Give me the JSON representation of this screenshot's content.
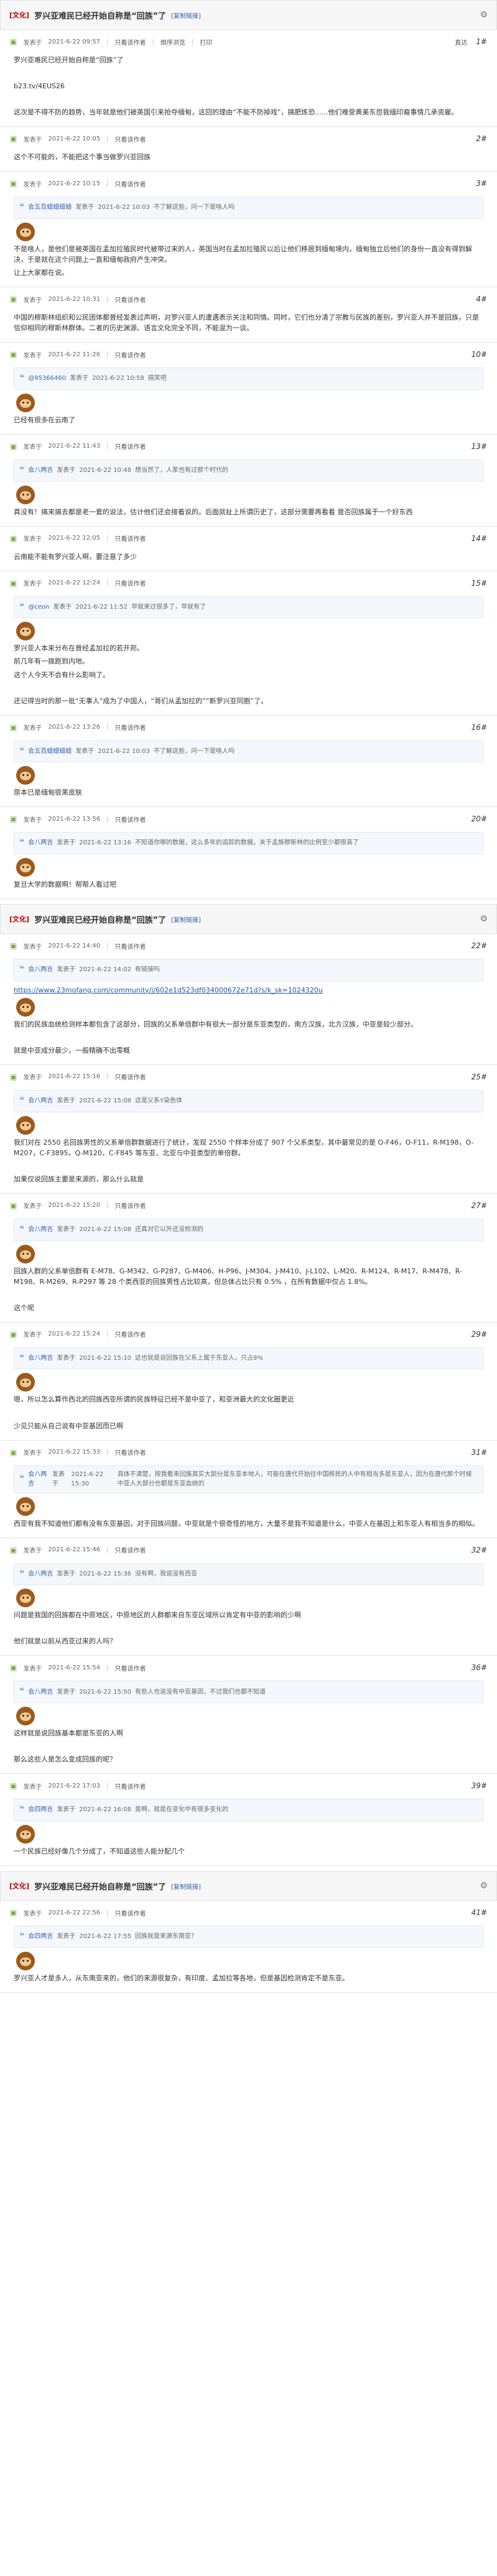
{
  "thread": {
    "category": "[文化]",
    "title": "罗兴亚难民已经开始自称是“回族”了",
    "copy": "[复制链接]",
    "tools_icon": "gear-icon"
  },
  "common": {
    "posted_prefix": "发表于",
    "only_author": "只看该作者",
    "reverse": "倒序浏览",
    "print": "打印",
    "jump": "直达"
  },
  "posts": [
    {
      "floor": "1#",
      "time": "2021-6-22 09:57",
      "meta_extra": true,
      "body": [
        "罗兴亚难民已经开始自称是“回族”了",
        "",
        "b23.tv/4EUS26",
        "",
        "这次是不得不防的趋势，当年就是他们被英国引来抢夺缅甸，这回的理由“不能不防掉戏”，搞肥炼恐......他们难受黄美东怨我缅印裔事情几承资雇。"
      ]
    },
    {
      "floor": "2#",
      "time": "2021-6-22 10:05",
      "body": [
        "这个不可能的，不能把这个事当做罗兴亚回族"
      ]
    },
    {
      "floor": "3#",
      "time": "2021-6-22 10:15",
      "quote": {
        "user": "会五百蜡蜡蜡蜡",
        "time": "2021-6-22 10:03",
        "text": "不了解这些，问一下是啥人吗"
      },
      "body": [
        "不是啥人，是他们是被英国在孟加拉殖民时代被带过来的人，英国当时在孟加拉殖民以后让他们移居到缅甸境内，缅甸独立后他们的身份一直没有得到解决，于是就在这个问题上一直和缅甸政府产生冲突。",
        "让上大家都在说。"
      ]
    },
    {
      "floor": "4#",
      "time": "2021-6-22 10:31",
      "body": [
        "中国的穆斯林组织和公民团体都曾经发表过声明，对罗兴亚人的遭遇表示关注和同情。同时，它们也分清了宗教与民族的差别，罗兴亚人并不是回族，只是信仰相同的穆斯林群体。二者的历史渊源、语言文化完全不同，不能混为一谈。"
      ]
    },
    {
      "floor": "10#",
      "time": "2021-6-22 11:26",
      "quote": {
        "user": "@95366460",
        "time": "2021-6-22 10:58",
        "text": "搞笑吧"
      },
      "body": [
        "已经有很多在云南了"
      ]
    },
    {
      "floor": "13#",
      "time": "2021-6-22 11:43",
      "quote": {
        "user": "会八两吉",
        "time": "2021-6-22 10:48",
        "text": "想当然了，人家也有过那个时代的"
      },
      "body": [
        "真没有！搞来搞去都是老一套的说法，估计他们还会接着说的。后面就扯上所谓历史了，这部分需要再看看 是否回族属于一个好东西"
      ]
    },
    {
      "floor": "14#",
      "time": "2021-6-22 12:05",
      "body": [
        "云南能不能有罗兴亚人啊，要注意了多少"
      ]
    },
    {
      "floor": "15#",
      "time": "2021-6-22 12:24",
      "quote": {
        "user": "@ceon",
        "time": "2021-6-22 11:52",
        "text": "早就来过很多了，早就有了"
      },
      "body": [
        "罗兴亚人本来分布在曾经孟加拉的若开邦。",
        "前几年有一拨跑到内地。",
        "这个人今天不会有什么影响了。",
        "",
        "还记得当时的那一批“无事人”成为了中国人，“哥们从孟加拉的”“新罗兴亚同胞”了。"
      ]
    },
    {
      "floor": "16#",
      "time": "2021-6-22 13:26",
      "quote": {
        "user": "会五百蜡蜡蜡蜡",
        "time": "2021-6-22 10:03",
        "text": "不了解这些，问一下是啥人吗"
      },
      "body": [
        "原本已是缅甸很黑皮肤"
      ]
    },
    {
      "floor": "20#",
      "time": "2021-6-22 13:56",
      "quote": {
        "user": "会八两吉",
        "time": "2021-6-22 13:16",
        "text": "不知道你哪的数据，这么多年的追踪的数据，关于孟族穆斯林的比例至少都很高了"
      },
      "body": [
        "复旦大学的数据啊！帮帮人看过吧"
      ]
    }
  ],
  "thread2": {
    "category": "[文化]",
    "title": "罗兴亚难民已经开始自称是“回族”了",
    "copy": "[复制链接]"
  },
  "posts2": [
    {
      "floor": "22#",
      "time": "2021-6-22 14:40",
      "quote": {
        "user": "会八两吉",
        "time": "2021-6-22 14:02",
        "text": "有链接吗"
      },
      "link": "https://www.23mofang.com/community/i/602e1d523df034000672e71d?s/k_sk=1024320u",
      "body": [
        "我们的民族血统检测样本都包含了这部分，回族的父系单倍群中有很大一部分是东亚类型的，南方汉族，北方汉族，中亚是较少部分。",
        "",
        "就是中亚成分最少，一般精确不出零概"
      ]
    },
    {
      "floor": "25#",
      "time": "2021-6-22 15:16",
      "quote": {
        "user": "会八两吉",
        "time": "2021-6-22 15:08",
        "text": "这是父系Y染色体"
      },
      "body": [
        "我们对在 2550 名回族男性的父系单倍群数据进行了统计，发现 2550 个样本分成了 907 个父系类型，其中最常见的是 O-F46，O-F11，R-M198，O-M207，C-F3895，Q-M120，C-F845 等东亚、北亚与中亚类型的单倍群。",
        "",
        "加果仅说回族主要是来源的，那么什么就是"
      ]
    },
    {
      "floor": "27#",
      "time": "2021-6-22 15:20",
      "quote": {
        "user": "会八两吉",
        "time": "2021-6-22 15:08",
        "text": "还真对它以外还没检测的"
      },
      "body": [
        "回族人群的父系单倍群有 E-M78、G-M342、G-P287、G-M406、H-P96、J-M304、J-M410、J-L102、L-M20、R-M124、R-M17、R-M478、R-M198、R-M269、R-P297 等 28 个类西亚的回族男性占比较高，但总体占比只有 0.5% ，在所有数据中仅占 1.8%。",
        "",
        "这个呢"
      ]
    },
    {
      "floor": "29#",
      "time": "2021-6-22 15:24",
      "quote": {
        "user": "会八两吉",
        "time": "2021-6-22 15:10",
        "text": "这也就是说回族在父系上属于东亚人，只占9%"
      },
      "body": [
        "嗯，所以怎么算作西北的回族西亚所谓的民族特征已经不是中亚了，和亚洲最大的文化圈更近",
        "",
        "少见只能从自己说有中亚基因而已啊"
      ]
    },
    {
      "floor": "31#",
      "time": "2021-6-22 15:33",
      "quote": {
        "user": "会八两吉",
        "time": "2021-6-22 15:30",
        "text": "具体不清楚，按我看来回族其实大部分是东亚本地人，可能在唐代开始往中国移民的人中有相当多是东亚人，因为在唐代那个时候中亚人大部分也都是东亚血统的"
      },
      "body": [
        "西亚有我不知道他们都有没有东亚基因，对于回族问题，中亚就是个很奇怪的地方，大量不是我不知道是什么，中亚人在基因上和东亚人有相当多的相似。"
      ]
    },
    {
      "floor": "32#",
      "time": "2021-6-22 15:46",
      "quote": {
        "user": "会八两吉",
        "time": "2021-6-22 15:36",
        "text": "没有啊，我说没有西亚"
      },
      "body": [
        "问题是我国的回族都在中原地区，中原地区的人群都来自东亚区域所以肯定有中亚的影响的少啊",
        "",
        "他们就是以前从西亚过来的人吗？"
      ]
    },
    {
      "floor": "36#",
      "time": "2021-6-22 15:54",
      "quote": {
        "user": "会八两吉",
        "time": "2021-6-22 15:50",
        "text": "有些人也说没有中亚基因，不过我们也都不知道"
      },
      "body": [
        "这样就是说回族基本都是东亚的人啊",
        "",
        "那么这些人是怎么变成回族的呢？"
      ]
    },
    {
      "floor": "39#",
      "time": "2021-6-22 17:03",
      "quote": {
        "user": "会四两吉",
        "time": "2021-6-22 16:08",
        "text": "是啊，就是在变化中有很多变化的"
      },
      "body": [
        "一个民族已经好像几个分成了，不知道这些人能分配几个"
      ]
    }
  ],
  "thread3": {
    "category": "[文化]",
    "title": "罗兴亚难民已经开始自称是“回族”了",
    "copy": "[复制链接]"
  },
  "posts3": [
    {
      "floor": "41#",
      "time": "2021-6-22 22:56",
      "quote": {
        "user": "会四两吉",
        "time": "2021-6-22 17:55",
        "text": "回族就是来源东南亚？"
      },
      "body": [
        "罗兴亚人才是多人，从东南亚来的，他们的来源很复杂，有印度、孟加拉等各地，但是基因检测肯定不是东亚。"
      ]
    }
  ]
}
